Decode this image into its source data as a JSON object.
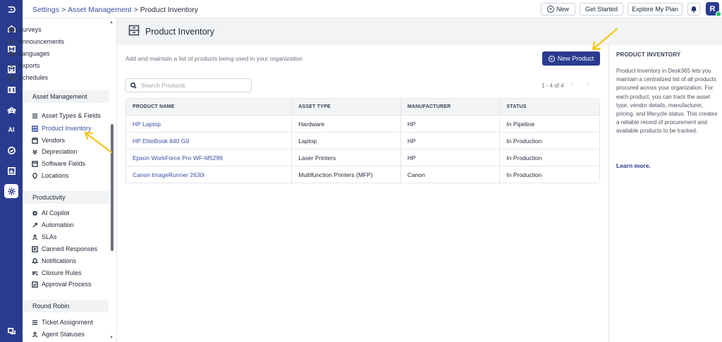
{
  "header": {
    "breadcrumb": {
      "settings": "Settings",
      "section": "Asset Management",
      "current": "Product Inventory",
      "sep": ">"
    },
    "new_label": "New",
    "get_started_label": "Get Started",
    "plan_label": "Explore My Plan",
    "avatar_initial": "R"
  },
  "sidebar": {
    "top_items": [
      "Surveys",
      "Announcements",
      "Languages",
      "Exports",
      "Schedules"
    ],
    "asset_section": "Asset Management",
    "asset_items": [
      "Asset Types & Fields",
      "Product Inventory",
      "Vendors",
      "Depreciation",
      "Software Fields",
      "Locations"
    ],
    "productivity_section": "Productivity",
    "productivity_items": [
      "AI Copilot",
      "Automation",
      "SLAs",
      "Canned Responses",
      "Notifications",
      "Closure Rules",
      "Approval Process"
    ],
    "round_robin_section": "Round Robin",
    "round_robin_items": [
      "Ticket Assignment",
      "Agent Statuses"
    ]
  },
  "rail": {
    "ai_label": "AI"
  },
  "page": {
    "title": "Product Inventory",
    "subtitle": "Add and maintain a list of products being used in your organization",
    "new_product_label": "New Product",
    "search_placeholder": "Search Products",
    "pager_text": "1 - 4 of 4"
  },
  "table": {
    "headers": [
      "PRODUCT NAME",
      "ASSET TYPE",
      "MANUFACTURER",
      "STATUS"
    ],
    "rows": [
      [
        "HP Laptop",
        "Hardware",
        "HP",
        "In Pipeline"
      ],
      [
        "HP EliteBook 840 G9",
        "Laptop",
        "HP",
        "In Production"
      ],
      [
        "Epson WorkForce Pro WF-M5299",
        "Laser Printers",
        "HP",
        "In Production"
      ],
      [
        "Canon ImageRunner 2630i",
        "Multifunction Printers (MFP)",
        "Canon",
        "In Production"
      ]
    ]
  },
  "info_panel": {
    "title": "PRODUCT INVENTORY",
    "body": "Product Inventory in Desk365 lets you maintain a centralized list of all products procured across your organization. For each product, you can track the asset type, vendor details, manufacturer, pricing, and lifecycle status. This creates a reliable record of procurement and available products to be tracked.",
    "link": "Learn more."
  },
  "colors": {
    "brand": "#2a3b8f",
    "link": "#3a4fa6",
    "annotation": "#f5c518"
  }
}
